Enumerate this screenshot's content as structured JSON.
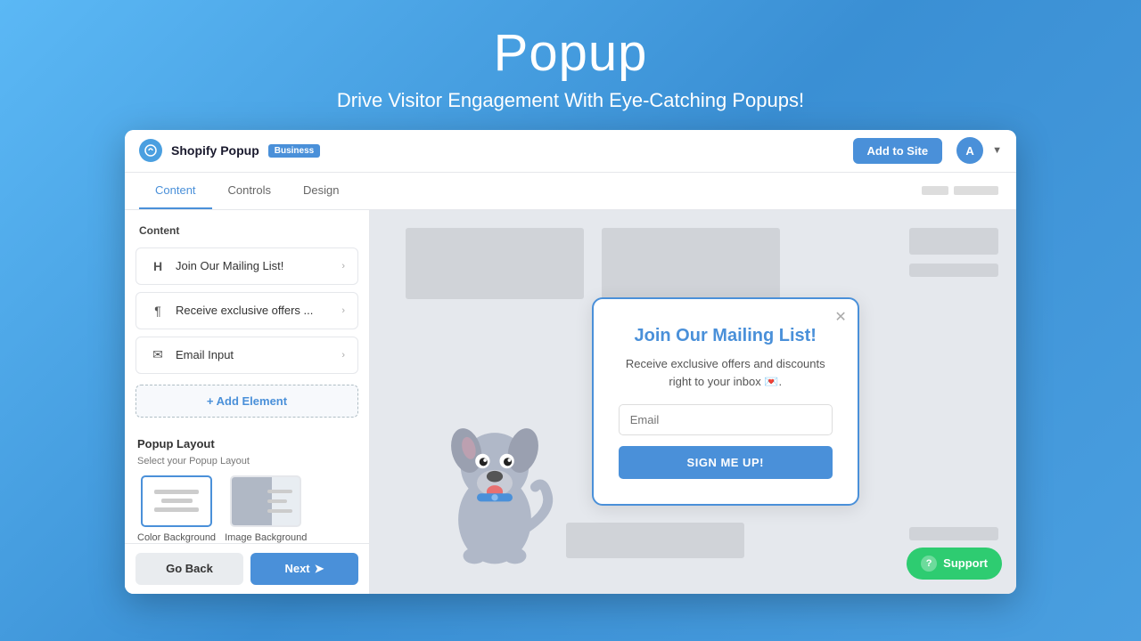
{
  "hero": {
    "title": "Popup",
    "subtitle": "Drive Visitor Engagement With Eye-Catching Popups!"
  },
  "topbar": {
    "logo_letter": "✦",
    "app_name": "Shopify Popup",
    "badge": "Business",
    "add_to_site_label": "Add to Site",
    "avatar_letter": "A"
  },
  "tabs": [
    {
      "label": "Content",
      "active": true
    },
    {
      "label": "Controls",
      "active": false
    },
    {
      "label": "Design",
      "active": false
    }
  ],
  "sidebar": {
    "content_section_title": "Content",
    "items": [
      {
        "icon": "H",
        "label": "Join Our Mailing List!"
      },
      {
        "icon": "¶",
        "label": "Receive exclusive offers ..."
      },
      {
        "icon": "✉",
        "label": "Email Input"
      }
    ],
    "add_element_label": "+ Add Element",
    "popup_layout_title": "Popup Layout",
    "popup_layout_subtitle": "Select your Popup Layout",
    "layout_options": [
      {
        "label": "Color Background",
        "selected": true
      },
      {
        "label": "Image Background",
        "selected": false
      }
    ]
  },
  "bottom_buttons": {
    "go_back": "Go Back",
    "next": "Next"
  },
  "popup": {
    "title": "Join Our Mailing List!",
    "description": "Receive exclusive offers and discounts right to your inbox 💌.",
    "email_placeholder": "Email",
    "submit_label": "SIGN ME UP!"
  },
  "support": {
    "label": "Support"
  }
}
